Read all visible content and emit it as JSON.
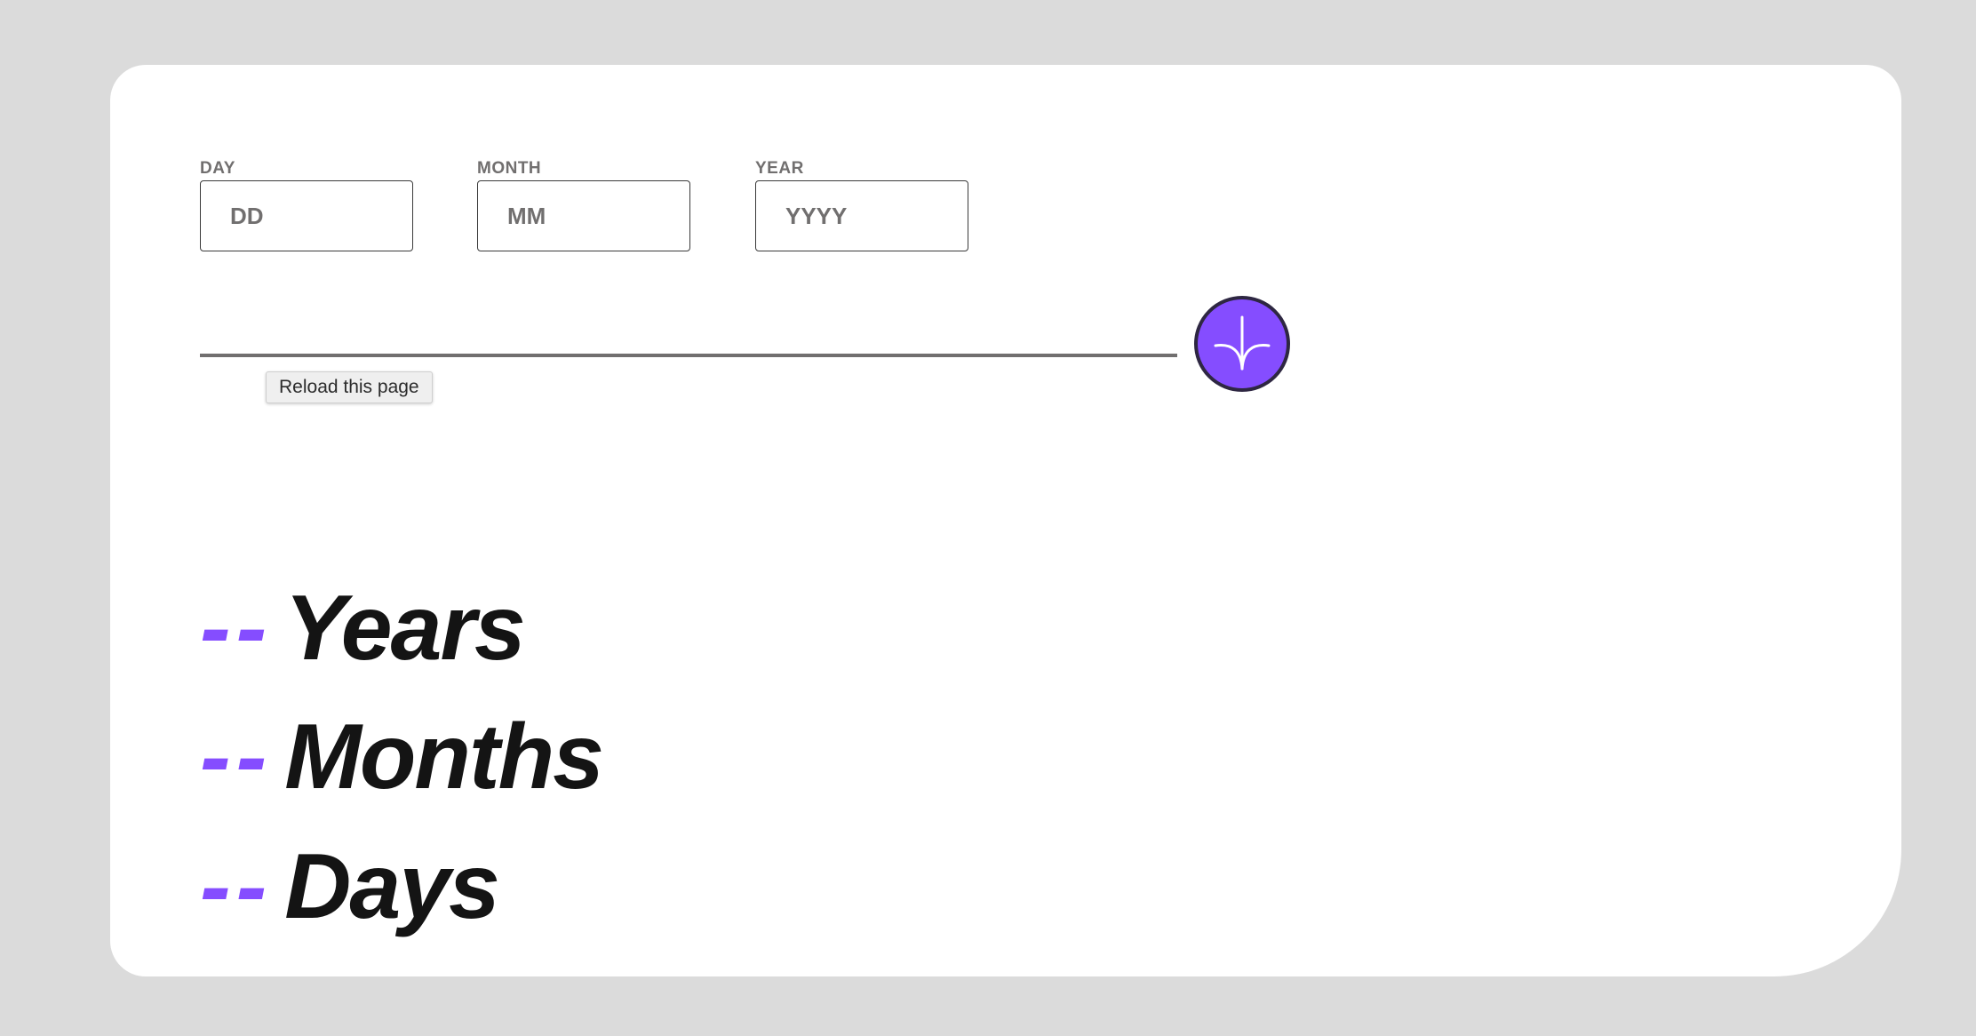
{
  "form": {
    "day": {
      "label": "DAY",
      "placeholder": "DD",
      "value": ""
    },
    "month": {
      "label": "MONTH",
      "placeholder": "MM",
      "value": ""
    },
    "year": {
      "label": "YEAR",
      "placeholder": "YYYY",
      "value": ""
    }
  },
  "submit": {
    "icon": "arrow-down-icon"
  },
  "tooltip": {
    "text": "Reload this page"
  },
  "results": [
    {
      "value": "--",
      "unit": "Years"
    },
    {
      "value": "--",
      "unit": "Months"
    },
    {
      "value": "--",
      "unit": "Days"
    }
  ],
  "colors": {
    "accent": "#854dff",
    "background": "#dbdbdb",
    "card": "#ffffff",
    "label": "#716f6f",
    "text": "#141414"
  }
}
